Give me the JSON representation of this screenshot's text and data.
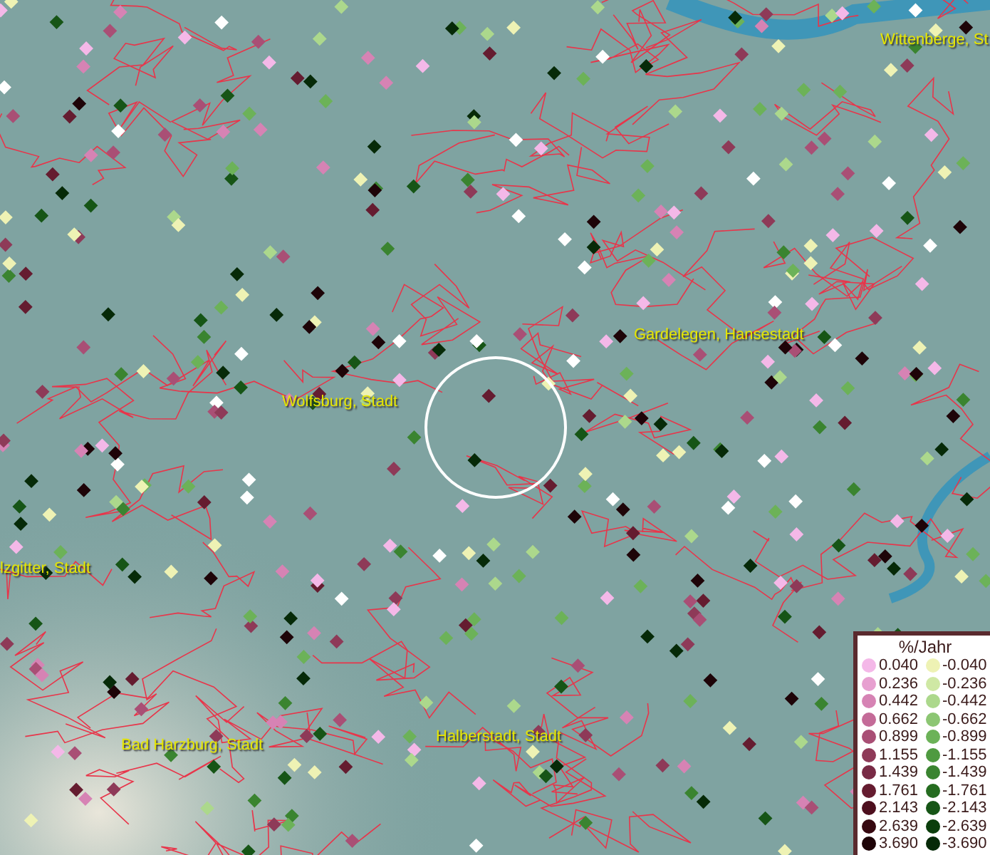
{
  "map": {
    "places": [
      {
        "label": "Wittenberge, St"
      },
      {
        "label": "Gardelegen, Hansestadt"
      },
      {
        "label": "Wolfsburg, Stadt"
      },
      {
        "label": "lzgitter, Stadt"
      },
      {
        "label": "Bad Harzburg, Stadt"
      },
      {
        "label": "Halberstadt, Stadt"
      }
    ]
  },
  "legend": {
    "title": "%/Jahr",
    "rows": [
      {
        "positive": {
          "label": "0.040",
          "color": "#f4b8e8"
        },
        "negative": {
          "label": "-0.040",
          "color": "#eef2b4"
        }
      },
      {
        "positive": {
          "label": "0.236",
          "color": "#e7a0d0"
        },
        "negative": {
          "label": "-0.236",
          "color": "#cfe8a4"
        }
      },
      {
        "positive": {
          "label": "0.442",
          "color": "#d683b4"
        },
        "negative": {
          "label": "-0.442",
          "color": "#acd88c"
        }
      },
      {
        "positive": {
          "label": "0.662",
          "color": "#c46b98"
        },
        "negative": {
          "label": "-0.662",
          "color": "#8cc673"
        }
      },
      {
        "positive": {
          "label": "0.899",
          "color": "#a94f75"
        },
        "negative": {
          "label": "-0.899",
          "color": "#6cb258"
        }
      },
      {
        "positive": {
          "label": "1.155",
          "color": "#8e3a58"
        },
        "negative": {
          "label": "-1.155",
          "color": "#4f9a40"
        }
      },
      {
        "positive": {
          "label": "1.439",
          "color": "#782a45"
        },
        "negative": {
          "label": "-1.439",
          "color": "#3a8430"
        }
      },
      {
        "positive": {
          "label": "1.761",
          "color": "#651c30"
        },
        "negative": {
          "label": "-1.761",
          "color": "#256c20"
        }
      },
      {
        "positive": {
          "label": "2.143",
          "color": "#4d0f1e"
        },
        "negative": {
          "label": "-2.143",
          "color": "#165516"
        }
      },
      {
        "positive": {
          "label": "2.639",
          "color": "#360810"
        },
        "negative": {
          "label": "-2.639",
          "color": "#0b3e0c"
        }
      },
      {
        "positive": {
          "label": "3.690",
          "color": "#1e0408"
        },
        "negative": {
          "label": "-3.690",
          "color": "#062a08"
        }
      }
    ]
  }
}
